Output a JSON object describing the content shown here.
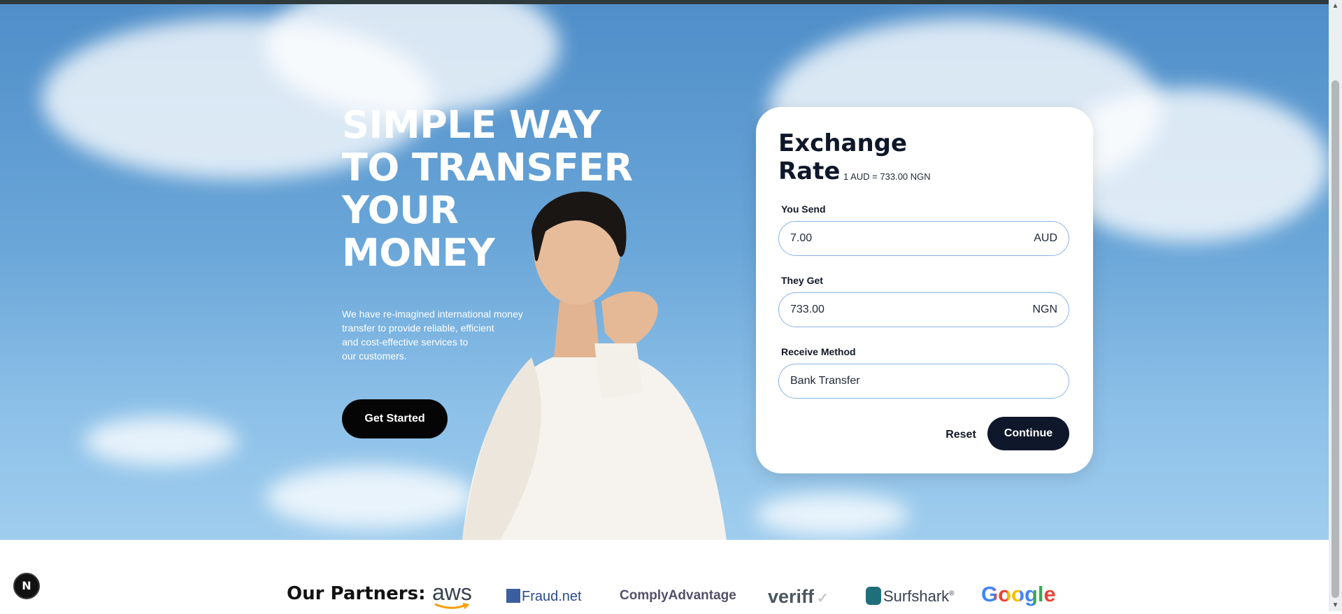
{
  "hero": {
    "headline_lines": [
      "SIMPLE WAY",
      "TO TRANSFER",
      "YOUR",
      "MONEY"
    ],
    "description_lines": [
      "We have re-imagined international money",
      "transfer to provide reliable, efficient",
      "and cost-effective services to",
      "our customers."
    ],
    "cta_label": "Get Started"
  },
  "exchange": {
    "title_lines": [
      "Exchange",
      "Rate"
    ],
    "rate_text": "1 AUD = 733.00 NGN",
    "send_label": "You Send",
    "send_value": "7.00",
    "send_currency": "AUD",
    "get_label": "They Get",
    "get_value": "733.00",
    "get_currency": "NGN",
    "method_label": "Receive Method",
    "method_value": "Bank Transfer",
    "reset_label": "Reset",
    "continue_label": "Continue"
  },
  "partners": {
    "title": "Our Partners:",
    "logos": [
      "aws",
      "Fraud.net",
      "ComplyAdvantage",
      "veriff",
      "Surfshark",
      "Google"
    ]
  },
  "badge": {
    "letter": "N"
  },
  "colors": {
    "primary_dark": "#0f172a",
    "cta_black": "#050505",
    "field_border": "#8ab4e6",
    "sky": "#6aa6d8"
  }
}
